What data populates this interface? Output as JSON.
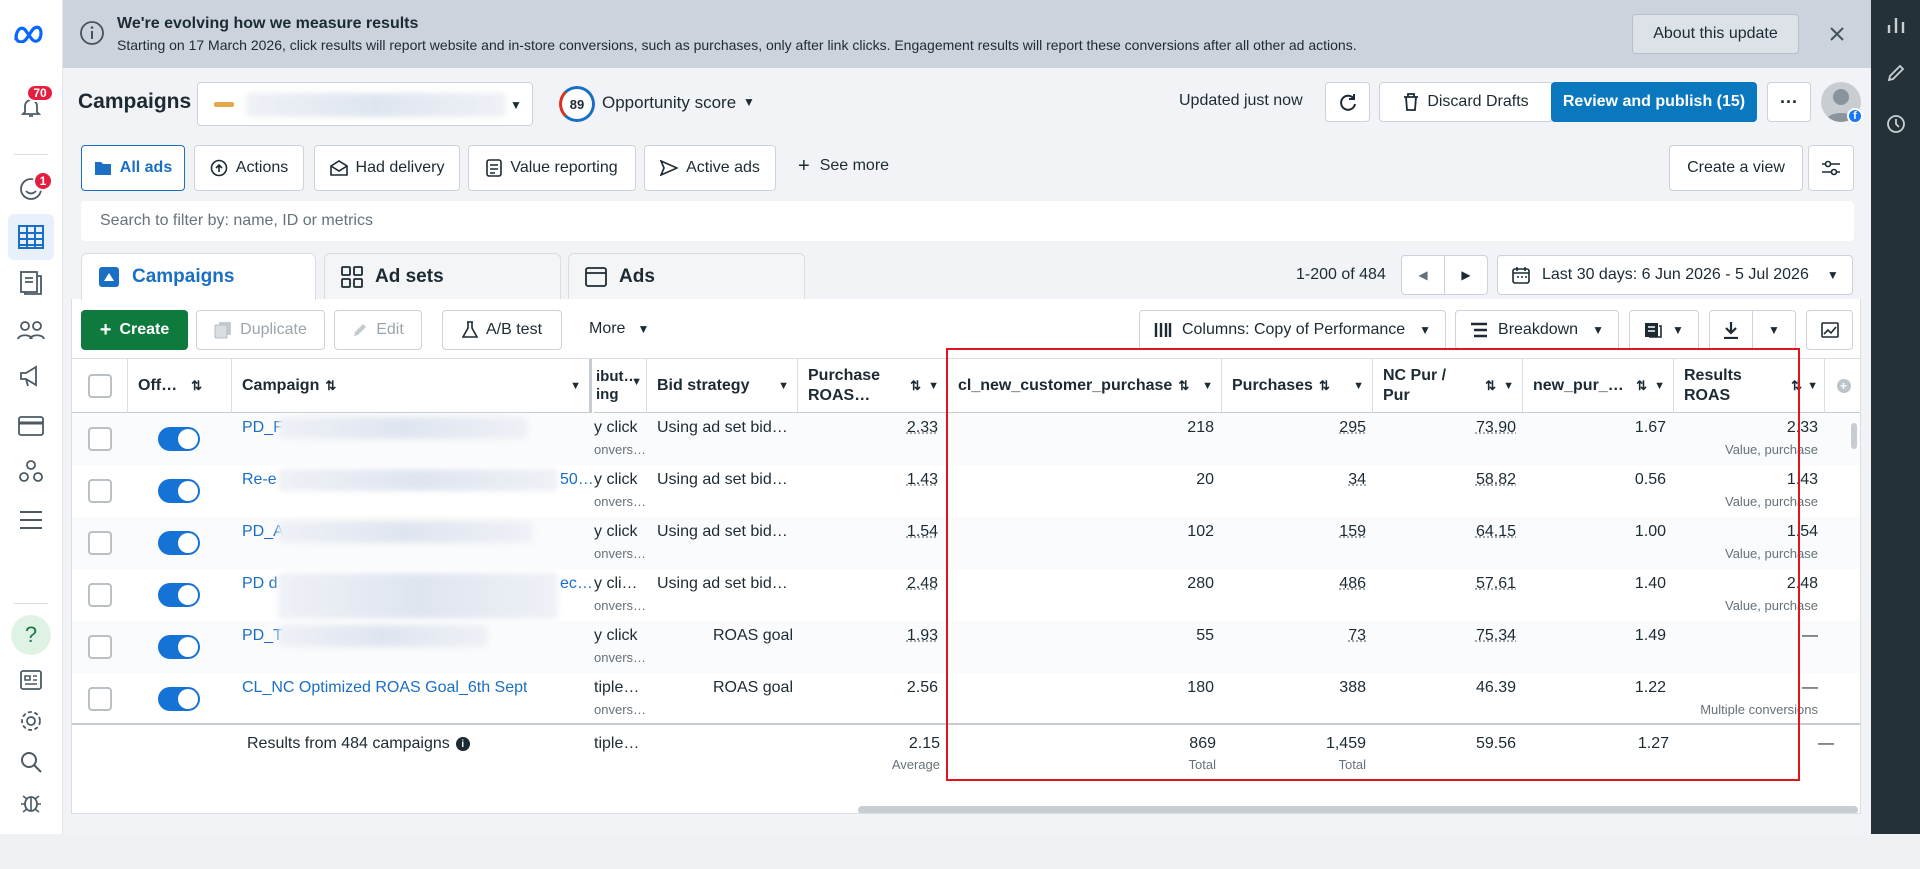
{
  "sidebar": {
    "notifications_count": "70",
    "alerts_count": "1"
  },
  "banner": {
    "title": "We're evolving how we measure results",
    "body": "Starting on 17 March 2026, click results will report website and in-store conversions, such as purchases, only after link clicks. Engagement results will report these conversions after all other ad actions.",
    "about_button": "About this update"
  },
  "header": {
    "title": "Campaigns",
    "opportunity_score_value": "89",
    "opportunity_score_label": "Opportunity score",
    "updated_text": "Updated just now",
    "discard_label": "Discard Drafts",
    "publish_label": "Review and publish (15)"
  },
  "filters": {
    "chips": [
      "All ads",
      "Actions",
      "Had delivery",
      "Value reporting",
      "Active ads"
    ],
    "see_more": "See more",
    "create_view": "Create a view",
    "search_placeholder": "Search to filter by: name, ID or metrics"
  },
  "tabs": {
    "campaigns": "Campaigns",
    "adsets": "Ad sets",
    "ads": "Ads"
  },
  "pagination": {
    "range": "1-200 of 484",
    "date_range": "Last 30 days: 6 Jun 2026 - 5 Jul 2026"
  },
  "toolbar": {
    "create": "Create",
    "duplicate": "Duplicate",
    "edit": "Edit",
    "ab_test": "A/B test",
    "more": "More",
    "columns": "Columns: Copy of Performance",
    "breakdown": "Breakdown"
  },
  "table": {
    "headers": {
      "off_on": "Off…",
      "campaign": "Campaign",
      "attribution": "ibut…\ning",
      "bid_strategy": "Bid strategy",
      "purchase_roas": "Purchase\nROAS…",
      "cl_new": "cl_new_customer_purchase",
      "purchases": "Purchases",
      "nc_pur": "NC Pur /\nPur",
      "new_pur": "new_pur_…",
      "results_roas": "Results\nROAS"
    },
    "rows": [
      {
        "name": "PD_F",
        "attr": "y click",
        "attr_sub": "onvers…",
        "bid": "Using ad set bid…",
        "proas": "2.33",
        "cl_new": "218",
        "purchases": "295",
        "nc_pur": "73.90",
        "new_pur": "1.67",
        "results_roas": "2.33",
        "results_sub": "Value, purchase"
      },
      {
        "name": "Re-e",
        "name_tail": "50…",
        "attr": "y click",
        "attr_sub": "onvers…",
        "bid": "Using ad set bid…",
        "proas": "1.43",
        "cl_new": "20",
        "purchases": "34",
        "nc_pur": "58.82",
        "new_pur": "0.56",
        "results_roas": "1.43",
        "results_sub": "Value, purchase"
      },
      {
        "name": "PD_A",
        "attr": "y click",
        "attr_sub": "onvers…",
        "bid": "Using ad set bid…",
        "proas": "1.54",
        "cl_new": "102",
        "purchases": "159",
        "nc_pur": "64.15",
        "new_pur": "1.00",
        "results_roas": "1.54",
        "results_sub": "Value, purchase"
      },
      {
        "name": "PD d",
        "name_tail": "ec…",
        "attr": "y cli…",
        "attr_sub": "onvers…",
        "bid": "Using ad set bid…",
        "proas": "2.48",
        "cl_new": "280",
        "purchases": "486",
        "nc_pur": "57.61",
        "new_pur": "1.40",
        "results_roas": "2.48",
        "results_sub": "Value, purchase"
      },
      {
        "name": "PD_T",
        "attr": "y click",
        "attr_sub": "onvers…",
        "bid": "ROAS goal",
        "proas": "1.93",
        "cl_new": "55",
        "purchases": "73",
        "nc_pur": "75.34",
        "new_pur": "1.49",
        "results_roas": "—",
        "results_sub": ""
      },
      {
        "name": "CL_NC Optimized ROAS Goal_6th Sept",
        "attr": "tiple…",
        "attr_sub": "onvers…",
        "bid": "ROAS goal",
        "proas": "2.56",
        "cl_new": "180",
        "purchases": "388",
        "nc_pur": "46.39",
        "new_pur": "1.22",
        "results_roas": "—",
        "results_sub": "Multiple conversions"
      }
    ],
    "footer": {
      "label": "Results from 484 campaigns",
      "attr": "tiple…",
      "proas": "2.15",
      "proas_sub": "Average",
      "cl_new": "869",
      "cl_new_sub": "Total",
      "purchases": "1,459",
      "purchases_sub": "Total",
      "nc_pur": "59.56",
      "new_pur": "1.27",
      "results_roas": "—"
    }
  },
  "colors": {
    "primary": "#0a78be",
    "create_green": "#0e7a3d",
    "highlight_box": "#e0151e",
    "link": "#1a6fc4"
  }
}
